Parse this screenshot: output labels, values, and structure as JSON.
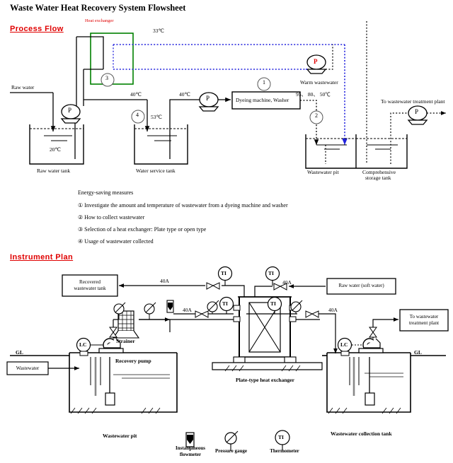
{
  "title": "Waste Water Heat Recovery System Flowsheet",
  "sections": {
    "process_flow": "Process Flow",
    "instrument_plan": "Instrument Plan"
  },
  "process_flow": {
    "heat_exchanger_label": "Heat exchanger",
    "temps": {
      "hx_out": "33℃",
      "raw_tank": "20℃",
      "service_in": "40℃",
      "service_tank": "53℃",
      "service_out": "40℃",
      "wastewater": "95、 80、 50℃"
    },
    "labels": {
      "raw_water": "Raw water",
      "raw_water_tank": "Raw water tank",
      "water_service_tank": "Water service tank",
      "dyeing_machine": "Dyeing machine, Washer",
      "warm_wastewater": "Warm wastewater",
      "wastewater_pit": "Wastewater pit",
      "storage_tank_l1": "Comprehensive",
      "storage_tank_l2": "storage tank",
      "to_treatment": "To wastewater treatment plant"
    },
    "pump_symbol": "P",
    "callouts": [
      "1",
      "2",
      "3",
      "4"
    ]
  },
  "measures": {
    "heading": "Energy-saving measures",
    "items": [
      "① Investigate the amount and temperature of wastewater from a dyeing machine and washer",
      "② How to collect wastewater",
      "③ Selection of a heat exchanger: Plate type or open type",
      "④ Usage of wastewater collected"
    ]
  },
  "instrument_plan": {
    "boxes": {
      "recovered_tank_l1": "Recovered",
      "recovered_tank_l2": "wastewater tank",
      "raw_water_soft": "Raw water (soft water)",
      "to_treatment_l1": "To wastewater",
      "to_treatment_l2": "treatment plant",
      "wastewater_in": "Wastewater"
    },
    "labels": {
      "strainer": "Strainer",
      "recovery_pump": "Recovery pump",
      "plate_hx": "Plate-type heat exchanger",
      "wastewater_pit": "Wastewater pit",
      "collection_tank": "Wastewater collection tank",
      "gl_left": "GL",
      "gl_right": "GL"
    },
    "pipe_sizes": [
      "40A",
      "40A",
      "40A",
      "40A"
    ],
    "instrument_tags": {
      "thermometer": "TI",
      "level_controller": "LC"
    }
  },
  "legend": {
    "items": [
      {
        "name": "flowmeter-symbol",
        "l1": "Instantaneous",
        "l2": "flowmeter"
      },
      {
        "name": "pressure-gauge-symbol",
        "l1": "Pressure gauge",
        "l2": ""
      },
      {
        "name": "thermometer-symbol",
        "l1": "Thermometer",
        "l2": "",
        "tag": "TI"
      }
    ]
  },
  "colors": {
    "accent_red": "#e00000",
    "hx_green": "#008000",
    "flow_blue": "#2222dd",
    "line_black": "#000000"
  }
}
